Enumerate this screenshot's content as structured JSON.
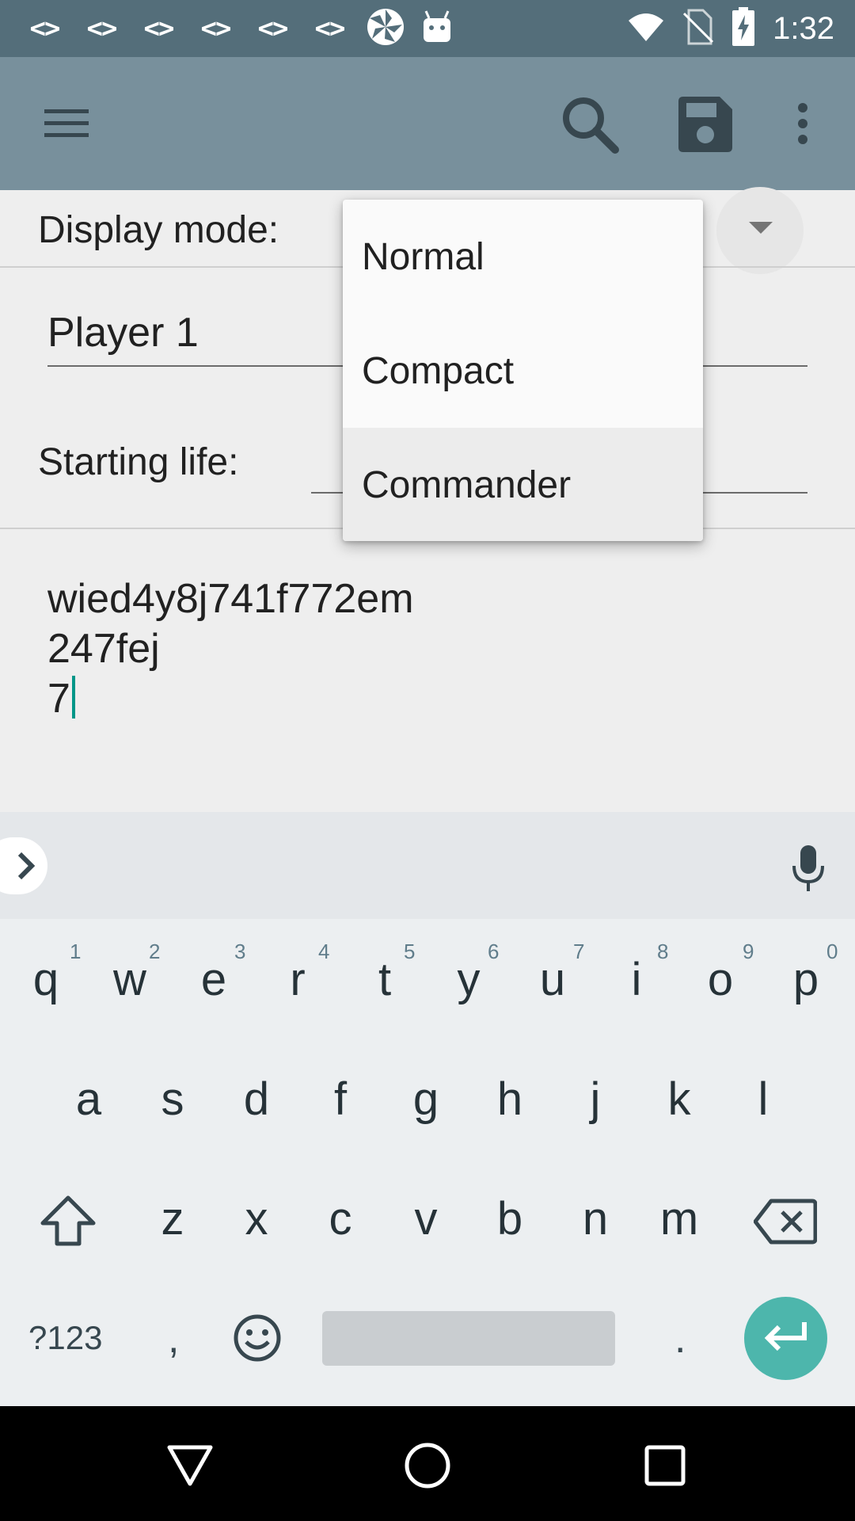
{
  "status_bar": {
    "left_codes": [
      "<>",
      "<>",
      "<>",
      "<>",
      "<>",
      "<>"
    ],
    "left_icons": [
      "pinwheel-icon",
      "android-icon"
    ],
    "right_icons": [
      "wifi-icon",
      "no-sim-icon",
      "battery-charging-icon"
    ],
    "time": "1:32"
  },
  "toolbar": {
    "icons": [
      "menu-icon",
      "search-icon",
      "save-icon",
      "more-vert-icon"
    ]
  },
  "form": {
    "display_mode_label": "Display mode:",
    "player_name_value": "Player 1",
    "starting_life_label": "Starting life:",
    "notes_lines": [
      "wied4y8j741f772em",
      "247fej",
      "7"
    ]
  },
  "dropdown": {
    "options": [
      "Normal",
      "Compact",
      "Commander"
    ],
    "highlighted": "Commander"
  },
  "keyboard": {
    "row1": [
      "q",
      "w",
      "e",
      "r",
      "t",
      "y",
      "u",
      "i",
      "o",
      "p"
    ],
    "row1_hints": [
      "1",
      "2",
      "3",
      "4",
      "5",
      "6",
      "7",
      "8",
      "9",
      "0"
    ],
    "row2": [
      "a",
      "s",
      "d",
      "f",
      "g",
      "h",
      "j",
      "k",
      "l"
    ],
    "row3": [
      "z",
      "x",
      "c",
      "v",
      "b",
      "n",
      "m"
    ],
    "symbols_key": "?123",
    "comma_key": ",",
    "period_key": ".",
    "icons": [
      "chevron-right-icon",
      "mic-icon",
      "shift-icon",
      "backspace-icon",
      "emoji-icon",
      "enter-icon"
    ]
  },
  "nav_bar": {
    "icons": [
      "back-icon",
      "home-icon",
      "recents-icon"
    ]
  },
  "colors": {
    "status_bar": "#546e7a",
    "toolbar": "#78909c",
    "accent": "#4db6ac",
    "cursor": "#009688"
  }
}
